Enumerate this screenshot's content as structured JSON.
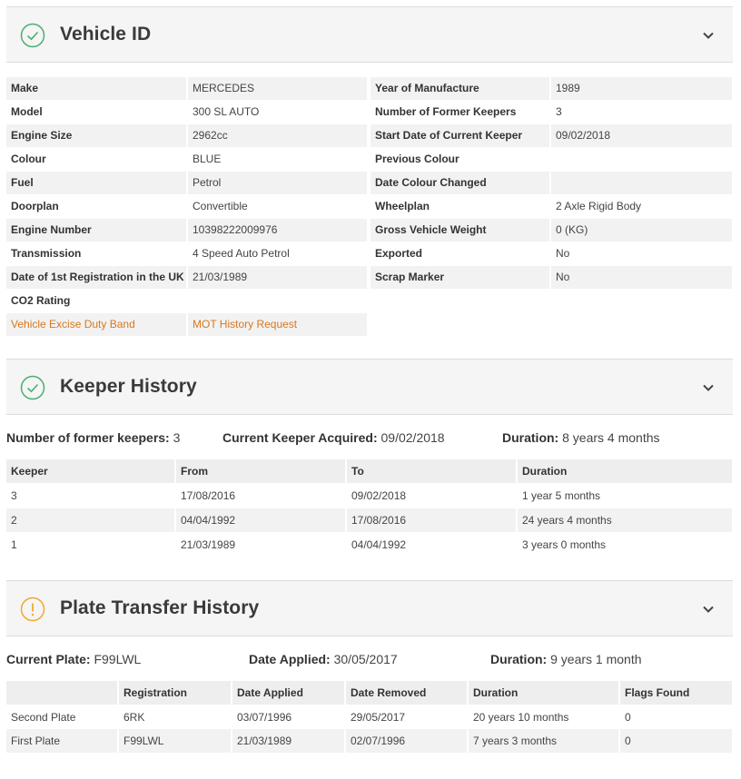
{
  "vehicle_id": {
    "title": "Vehicle ID",
    "icon": "check-circle-icon",
    "icon_color": "#4caf74",
    "left_rows": [
      {
        "key": "Make",
        "value": "MERCEDES"
      },
      {
        "key": "Model",
        "value": "300 SL AUTO"
      },
      {
        "key": "Engine Size",
        "value": "2962cc"
      },
      {
        "key": "Colour",
        "value": "BLUE"
      },
      {
        "key": "Fuel",
        "value": "Petrol"
      },
      {
        "key": "Doorplan",
        "value": "Convertible"
      },
      {
        "key": "Engine Number",
        "value": "10398222009976"
      },
      {
        "key": "Transmission",
        "value": "4 Speed Auto Petrol"
      },
      {
        "key": "Date of 1st Registration in the UK",
        "value": "21/03/1989"
      },
      {
        "key": "CO2 Rating",
        "value": ""
      }
    ],
    "links": {
      "ved_band": "Vehicle Excise Duty Band",
      "mot_history": "MOT History Request"
    },
    "link_color": "#d9771e",
    "right_rows": [
      {
        "key": "Year of Manufacture",
        "value": "1989"
      },
      {
        "key": "Number of Former Keepers",
        "value": "3"
      },
      {
        "key": "Start Date of Current Keeper",
        "value": "09/02/2018"
      },
      {
        "key": "Previous Colour",
        "value": ""
      },
      {
        "key": "Date Colour Changed",
        "value": ""
      },
      {
        "key": "Wheelplan",
        "value": "2 Axle Rigid Body"
      },
      {
        "key": "Gross Vehicle Weight",
        "value": "0 (KG)"
      },
      {
        "key": "Exported",
        "value": "No"
      },
      {
        "key": "Scrap Marker",
        "value": "No"
      }
    ]
  },
  "keeper_history": {
    "title": "Keeper History",
    "icon": "check-circle-icon",
    "summary": {
      "former_keepers_label": "Number of former keepers:",
      "former_keepers_value": "3",
      "acquired_label": "Current Keeper Acquired:",
      "acquired_value": "09/02/2018",
      "duration_label": "Duration:",
      "duration_value": "8 years 4 months"
    },
    "columns": [
      "Keeper",
      "From",
      "To",
      "Duration"
    ],
    "rows": [
      [
        "3",
        "17/08/2016",
        "09/02/2018",
        "1 year 5 months"
      ],
      [
        "2",
        "04/04/1992",
        "17/08/2016",
        "24 years 4 months"
      ],
      [
        "1",
        "21/03/1989",
        "04/04/1992",
        "3 years 0 months"
      ]
    ]
  },
  "plate_transfer": {
    "title": "Plate Transfer History",
    "icon": "exclamation-circle-icon",
    "icon_color": "#f0a92b",
    "summary": {
      "plate_label": "Current Plate:",
      "plate_value": "F99LWL",
      "applied_label": "Date Applied:",
      "applied_value": "30/05/2017",
      "duration_label": "Duration:",
      "duration_value": "9 years 1 month"
    },
    "columns": [
      "",
      "Registration",
      "Date Applied",
      "Date Removed",
      "Duration",
      "Flags Found"
    ],
    "rows": [
      [
        "Second Plate",
        "6RK",
        "03/07/1996",
        "29/05/2017",
        "20 years 10 months",
        "0"
      ],
      [
        "First Plate",
        "F99LWL",
        "21/03/1989",
        "02/07/1996",
        "7 years 3 months",
        "0"
      ]
    ]
  }
}
